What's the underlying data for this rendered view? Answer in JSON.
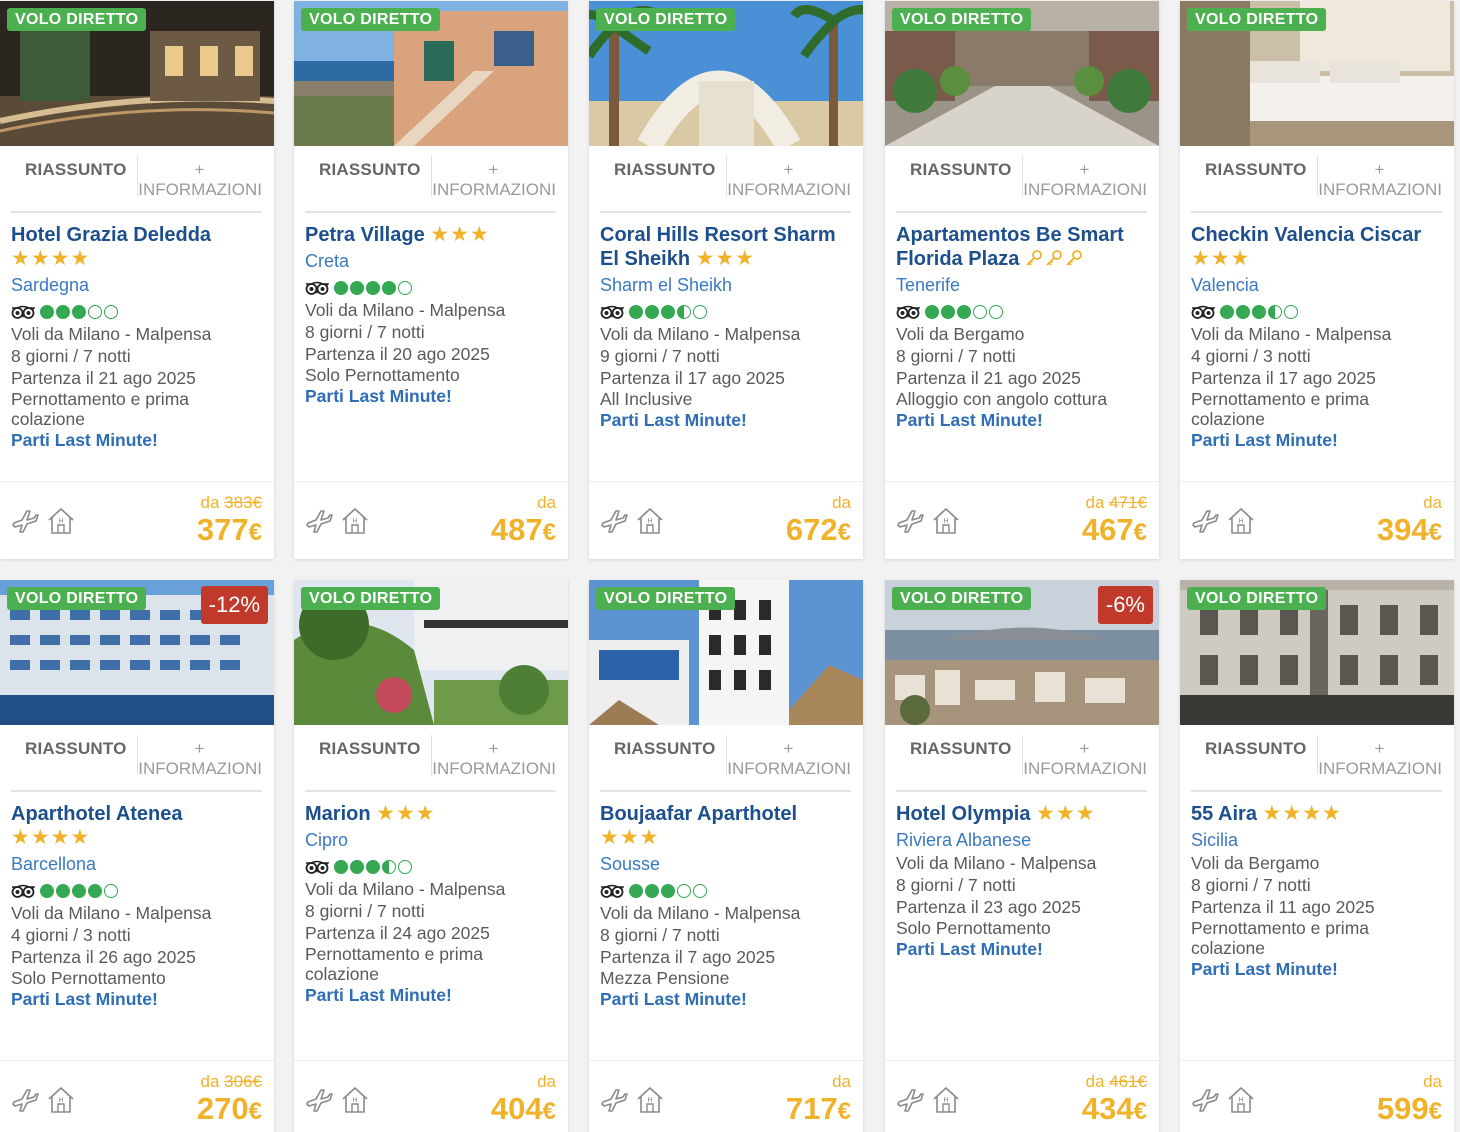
{
  "labels": {
    "direct_flight": "VOLO DIRETTO",
    "tab_summary": "RIASSUNTO",
    "tab_more_plus": "+",
    "tab_more": "INFORMAZIONI",
    "price_from": "da",
    "currency": "€"
  },
  "colors": {
    "direct_badge": "#4caf50",
    "discount_badge": "#c0392b",
    "hotel_name": "#1d4f8c",
    "location": "#3a79c0",
    "price": "#f0b22b",
    "rating": "#34a853"
  },
  "icons": [
    "tripadvisor-icon",
    "plane-icon",
    "house-icon",
    "star-icon",
    "key-icon"
  ],
  "hotels": [
    {
      "name": "Hotel Grazia Deledda",
      "stars": 4,
      "star_glyph": "★",
      "location": "Sardegna",
      "rating": 3,
      "rating_label": "",
      "flight": "Voli da Milano - Malpensa",
      "duration": "8 giorni / 7 notti",
      "departure": "Partenza il 21 ago 2025",
      "board": "Pernottamento e prima colazione",
      "cta": "Parti Last Minute!",
      "old_price": "383€",
      "price": "377",
      "discount": "",
      "photo": "street"
    },
    {
      "name": "Petra Village",
      "stars": 3,
      "star_glyph": "★",
      "location": "Creta",
      "rating": 4,
      "rating_label": "",
      "flight": "Voli da Milano - Malpensa",
      "duration": "8 giorni / 7 notti",
      "departure": "Partenza il 20 ago 2025",
      "board": "Solo Pernottamento",
      "cta": "Parti Last Minute!",
      "old_price": "",
      "price": "487",
      "discount": "",
      "photo": "village"
    },
    {
      "name": "Coral Hills Resort Sharm El Sheikh",
      "stars": 3,
      "star_glyph": "★",
      "location": "Sharm el Sheikh",
      "rating": 3.5,
      "rating_label": "",
      "flight": "Voli da Milano - Malpensa",
      "duration": "9 giorni / 7 notti",
      "departure": "Partenza il 17 ago 2025",
      "board": "All Inclusive",
      "cta": "Parti Last Minute!",
      "old_price": "",
      "price": "672",
      "discount": "",
      "photo": "palms"
    },
    {
      "name": "Apartamentos Be Smart Florida Plaza",
      "stars": 3,
      "star_glyph": "key",
      "location": "Tenerife",
      "rating": 3,
      "rating_label": "",
      "flight": "Voli da Bergamo",
      "duration": "8 giorni / 7 notti",
      "departure": "Partenza il 21 ago 2025",
      "board": "Alloggio con angolo cottura",
      "cta": "Parti Last Minute!",
      "old_price": "471€",
      "price": "467",
      "discount": "",
      "photo": "courtyard"
    },
    {
      "name": "Checkin Valencia Ciscar",
      "stars": 3,
      "star_glyph": "★",
      "location": "Valencia",
      "rating": 3.5,
      "rating_label": "",
      "flight": "Voli da Milano - Malpensa",
      "duration": "4 giorni / 3 notti",
      "departure": "Partenza il 17 ago 2025",
      "board": "Pernottamento e prima colazione",
      "cta": "Parti Last Minute!",
      "old_price": "",
      "price": "394",
      "discount": "",
      "photo": "room"
    },
    {
      "name": "Aparthotel Atenea",
      "stars": 4,
      "star_glyph": "★",
      "location": "Barcellona",
      "rating": 4,
      "rating_label": "",
      "flight": "Voli da Milano - Malpensa",
      "duration": "4 giorni / 3 notti",
      "departure": "Partenza il 26 ago 2025",
      "board": "Solo Pernottamento",
      "cta": "Parti Last Minute!",
      "old_price": "306€",
      "price": "270",
      "discount": "-12%",
      "photo": "building"
    },
    {
      "name": "Marion",
      "stars": 3,
      "star_glyph": "★",
      "location": "Cipro",
      "rating": 3.5,
      "rating_label": "",
      "flight": "Voli da Milano - Malpensa",
      "duration": "8 giorni / 7 notti",
      "departure": "Partenza il 24 ago 2025",
      "board": "Pernottamento e prima colazione",
      "cta": "Parti Last Minute!",
      "old_price": "",
      "price": "404",
      "discount": "",
      "photo": "garden"
    },
    {
      "name": "Boujaafar Aparthotel",
      "stars": 3,
      "star_glyph": "★",
      "location": "Sousse",
      "rating": 3,
      "rating_label": "",
      "flight": "Voli da Milano - Malpensa",
      "duration": "8 giorni / 7 notti",
      "departure": "Partenza il 7 ago 2025",
      "board": "Mezza Pensione",
      "cta": "Parti Last Minute!",
      "old_price": "",
      "price": "717",
      "discount": "",
      "photo": "tower"
    },
    {
      "name": "Hotel Olympia",
      "stars": 3,
      "star_glyph": "★",
      "location": "Riviera Albanese",
      "rating": 0,
      "rating_label": "",
      "flight": "Voli da Milano - Malpensa",
      "duration": "8 giorni / 7 notti",
      "departure": "Partenza il 23 ago 2025",
      "board": "Solo Pernottamento",
      "cta": "Parti Last Minute!",
      "old_price": "461€",
      "price": "434",
      "discount": "-6%",
      "photo": "bay"
    },
    {
      "name": "55 Aira",
      "stars": 4,
      "star_glyph": "★",
      "location": "Sicilia",
      "rating": 0,
      "rating_label": "",
      "flight": "Voli da Bergamo",
      "duration": "8 giorni / 7 notti",
      "departure": "Partenza il 11 ago 2025",
      "board": "Pernottamento e prima colazione",
      "cta": "Parti Last Minute!",
      "old_price": "",
      "price": "599",
      "discount": "",
      "photo": "facade"
    }
  ]
}
